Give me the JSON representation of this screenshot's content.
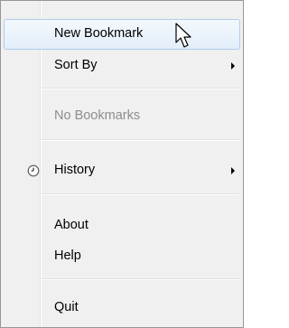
{
  "menu": {
    "items": [
      {
        "label": "New Bookmark",
        "state": "hovered"
      },
      {
        "label": "Sort By",
        "submenu": true
      },
      {
        "label": "No Bookmarks",
        "state": "disabled"
      },
      {
        "label": "History",
        "submenu": true,
        "icon": "clock-icon"
      },
      {
        "label": "About"
      },
      {
        "label": "Help"
      },
      {
        "label": "Quit"
      }
    ]
  },
  "colors": {
    "menu_background": "#f0f0f0",
    "hover_border": "#aeccef",
    "disabled_text": "#8d8d8d"
  }
}
